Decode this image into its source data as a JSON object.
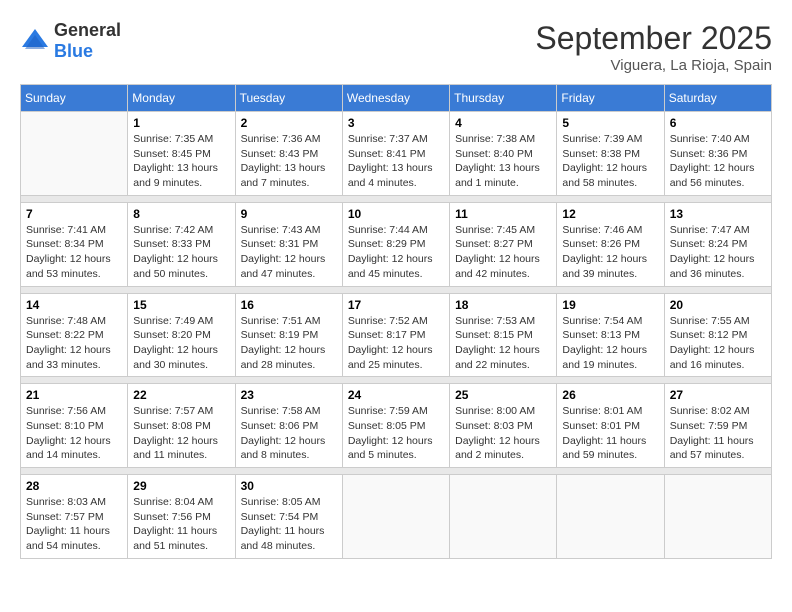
{
  "logo": {
    "general": "General",
    "blue": "Blue"
  },
  "title": "September 2025",
  "location": "Viguera, La Rioja, Spain",
  "weekdays": [
    "Sunday",
    "Monday",
    "Tuesday",
    "Wednesday",
    "Thursday",
    "Friday",
    "Saturday"
  ],
  "weeks": [
    [
      {
        "day": "",
        "info": ""
      },
      {
        "day": "1",
        "info": "Sunrise: 7:35 AM\nSunset: 8:45 PM\nDaylight: 13 hours\nand 9 minutes."
      },
      {
        "day": "2",
        "info": "Sunrise: 7:36 AM\nSunset: 8:43 PM\nDaylight: 13 hours\nand 7 minutes."
      },
      {
        "day": "3",
        "info": "Sunrise: 7:37 AM\nSunset: 8:41 PM\nDaylight: 13 hours\nand 4 minutes."
      },
      {
        "day": "4",
        "info": "Sunrise: 7:38 AM\nSunset: 8:40 PM\nDaylight: 13 hours\nand 1 minute."
      },
      {
        "day": "5",
        "info": "Sunrise: 7:39 AM\nSunset: 8:38 PM\nDaylight: 12 hours\nand 58 minutes."
      },
      {
        "day": "6",
        "info": "Sunrise: 7:40 AM\nSunset: 8:36 PM\nDaylight: 12 hours\nand 56 minutes."
      }
    ],
    [
      {
        "day": "7",
        "info": "Sunrise: 7:41 AM\nSunset: 8:34 PM\nDaylight: 12 hours\nand 53 minutes."
      },
      {
        "day": "8",
        "info": "Sunrise: 7:42 AM\nSunset: 8:33 PM\nDaylight: 12 hours\nand 50 minutes."
      },
      {
        "day": "9",
        "info": "Sunrise: 7:43 AM\nSunset: 8:31 PM\nDaylight: 12 hours\nand 47 minutes."
      },
      {
        "day": "10",
        "info": "Sunrise: 7:44 AM\nSunset: 8:29 PM\nDaylight: 12 hours\nand 45 minutes."
      },
      {
        "day": "11",
        "info": "Sunrise: 7:45 AM\nSunset: 8:27 PM\nDaylight: 12 hours\nand 42 minutes."
      },
      {
        "day": "12",
        "info": "Sunrise: 7:46 AM\nSunset: 8:26 PM\nDaylight: 12 hours\nand 39 minutes."
      },
      {
        "day": "13",
        "info": "Sunrise: 7:47 AM\nSunset: 8:24 PM\nDaylight: 12 hours\nand 36 minutes."
      }
    ],
    [
      {
        "day": "14",
        "info": "Sunrise: 7:48 AM\nSunset: 8:22 PM\nDaylight: 12 hours\nand 33 minutes."
      },
      {
        "day": "15",
        "info": "Sunrise: 7:49 AM\nSunset: 8:20 PM\nDaylight: 12 hours\nand 30 minutes."
      },
      {
        "day": "16",
        "info": "Sunrise: 7:51 AM\nSunset: 8:19 PM\nDaylight: 12 hours\nand 28 minutes."
      },
      {
        "day": "17",
        "info": "Sunrise: 7:52 AM\nSunset: 8:17 PM\nDaylight: 12 hours\nand 25 minutes."
      },
      {
        "day": "18",
        "info": "Sunrise: 7:53 AM\nSunset: 8:15 PM\nDaylight: 12 hours\nand 22 minutes."
      },
      {
        "day": "19",
        "info": "Sunrise: 7:54 AM\nSunset: 8:13 PM\nDaylight: 12 hours\nand 19 minutes."
      },
      {
        "day": "20",
        "info": "Sunrise: 7:55 AM\nSunset: 8:12 PM\nDaylight: 12 hours\nand 16 minutes."
      }
    ],
    [
      {
        "day": "21",
        "info": "Sunrise: 7:56 AM\nSunset: 8:10 PM\nDaylight: 12 hours\nand 14 minutes."
      },
      {
        "day": "22",
        "info": "Sunrise: 7:57 AM\nSunset: 8:08 PM\nDaylight: 12 hours\nand 11 minutes."
      },
      {
        "day": "23",
        "info": "Sunrise: 7:58 AM\nSunset: 8:06 PM\nDaylight: 12 hours\nand 8 minutes."
      },
      {
        "day": "24",
        "info": "Sunrise: 7:59 AM\nSunset: 8:05 PM\nDaylight: 12 hours\nand 5 minutes."
      },
      {
        "day": "25",
        "info": "Sunrise: 8:00 AM\nSunset: 8:03 PM\nDaylight: 12 hours\nand 2 minutes."
      },
      {
        "day": "26",
        "info": "Sunrise: 8:01 AM\nSunset: 8:01 PM\nDaylight: 11 hours\nand 59 minutes."
      },
      {
        "day": "27",
        "info": "Sunrise: 8:02 AM\nSunset: 7:59 PM\nDaylight: 11 hours\nand 57 minutes."
      }
    ],
    [
      {
        "day": "28",
        "info": "Sunrise: 8:03 AM\nSunset: 7:57 PM\nDaylight: 11 hours\nand 54 minutes."
      },
      {
        "day": "29",
        "info": "Sunrise: 8:04 AM\nSunset: 7:56 PM\nDaylight: 11 hours\nand 51 minutes."
      },
      {
        "day": "30",
        "info": "Sunrise: 8:05 AM\nSunset: 7:54 PM\nDaylight: 11 hours\nand 48 minutes."
      },
      {
        "day": "",
        "info": ""
      },
      {
        "day": "",
        "info": ""
      },
      {
        "day": "",
        "info": ""
      },
      {
        "day": "",
        "info": ""
      }
    ]
  ]
}
